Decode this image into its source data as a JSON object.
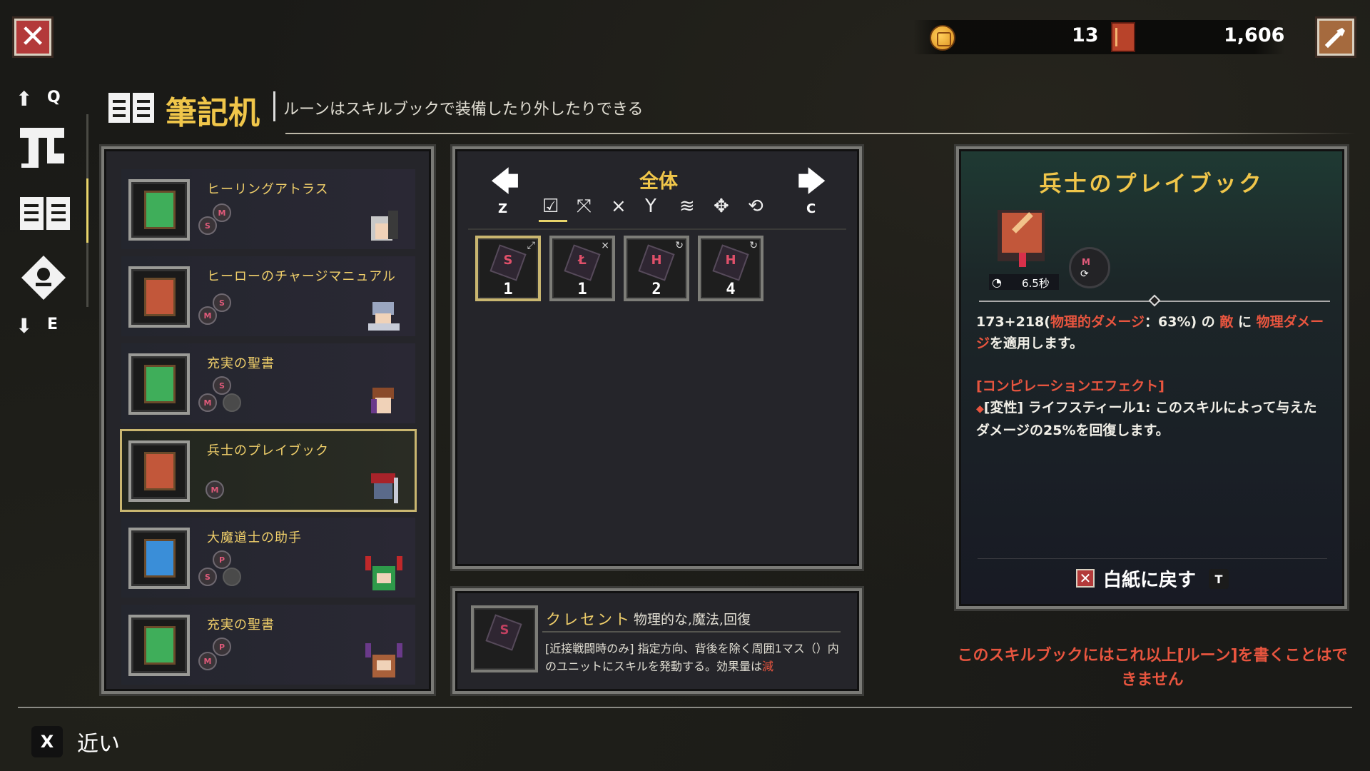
{
  "currency": {
    "coins": "13",
    "pages": "1,606"
  },
  "nav": {
    "up_key": "Q",
    "down_key": "E"
  },
  "header": {
    "title": "筆記机",
    "subtitle": "ルーンはスキルブックで装備したり外したりできる"
  },
  "skillbooks": [
    {
      "name": "ヒーリングアトラス",
      "runes": [
        "M",
        "S"
      ],
      "book_color": "#3fae5a"
    },
    {
      "name": "ヒーローのチャージマニュアル",
      "runes": [
        "S",
        "M"
      ],
      "book_color": "#c2573a"
    },
    {
      "name": "充実の聖書",
      "runes": [
        "S",
        "M",
        ""
      ],
      "book_color": "#3fae5a"
    },
    {
      "name": "兵士のプレイブック",
      "runes": [
        "M"
      ],
      "book_color": "#c2573a",
      "selected": true
    },
    {
      "name": "大魔道士の助手",
      "runes": [
        "P",
        "S",
        ""
      ],
      "book_color": "#3a8ed8"
    },
    {
      "name": "充実の聖書",
      "runes": [
        "P",
        "M"
      ],
      "book_color": "#3fae5a"
    }
  ],
  "rune_panel": {
    "category": "全体",
    "left_key": "Z",
    "right_key": "C",
    "runes": [
      {
        "glyph": "S",
        "count": "1",
        "corner": "⤢"
      },
      {
        "glyph": "Ł",
        "count": "1",
        "corner": "⨯"
      },
      {
        "glyph": "H",
        "count": "2",
        "corner": "↻"
      },
      {
        "glyph": "H",
        "count": "4",
        "corner": "↻"
      }
    ]
  },
  "rune_desc": {
    "name": "クレセント",
    "tags": "物理的な,魔法,回復",
    "text_main": "[近接戦闘時のみ] 指定方向、背後を除く周囲1マス（）内のユニットにスキルを発動する。効果量は",
    "text_red": "減"
  },
  "detail": {
    "title": "兵士のプレイブック",
    "cooldown": "6.5秒",
    "base": "173",
    "plus": "+",
    "bonus": "218(",
    "stat": "物理的ダメージ",
    "pct": "：63%)",
    "of": " の ",
    "enemy": "敵",
    "ni": " に ",
    "dmg": "物理ダメージ",
    "apply": "を適用します。",
    "effect_header": "[コンピレーションエフェクト]",
    "effect_text": "[変性] ライフスティール1: このスキルによって与えたダメージの25%を回復します。",
    "reset_label": "白紙に戻す",
    "reset_key": "T"
  },
  "warning": "このスキルブックにはこれ以上[ルーン]を書くことはできません",
  "footer": {
    "key": "X",
    "label": "近い"
  }
}
